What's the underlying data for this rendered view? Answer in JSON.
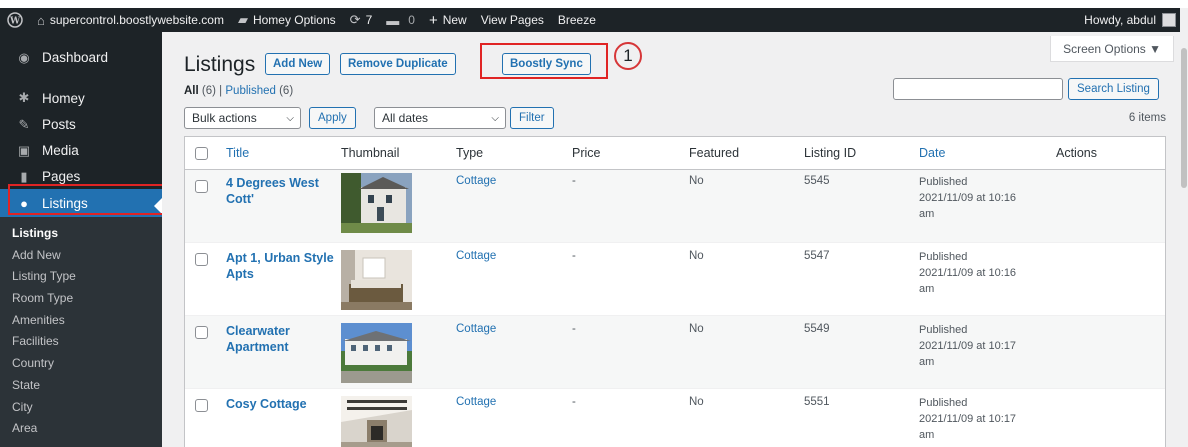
{
  "adminbar": {
    "site": "supercontrol.boostlywebsite.com",
    "homey_options": "Homey Options",
    "updates_count": "7",
    "comments_count": "0",
    "new_label": "New",
    "view_pages": "View Pages",
    "breeze": "Breeze",
    "howdy": "Howdy, abdul"
  },
  "sidebar": {
    "items": [
      {
        "label": "Dashboard",
        "icon": "dashboard-icon"
      },
      {
        "label": "Homey",
        "icon": "gear-icon"
      },
      {
        "label": "Posts",
        "icon": "pin-icon"
      },
      {
        "label": "Media",
        "icon": "media-icon"
      },
      {
        "label": "Pages",
        "icon": "page-icon"
      },
      {
        "label": "Listings",
        "icon": "location-pin-icon"
      }
    ],
    "submenu": [
      "Listings",
      "Add New",
      "Listing Type",
      "Room Type",
      "Amenities",
      "Facilities",
      "Country",
      "State",
      "City",
      "Area"
    ]
  },
  "header": {
    "title": "Listings",
    "add_new": "Add New",
    "remove_duplicate": "Remove Duplicate",
    "boostly_sync": "Boostly Sync",
    "annotation_number": "1",
    "screen_options": "Screen Options ▼"
  },
  "views": {
    "all_label": "All",
    "all_count": "(6)",
    "sep": "|",
    "published_label": "Published",
    "published_count": "(6)"
  },
  "search": {
    "button": "Search Listing",
    "value": ""
  },
  "filters": {
    "bulk_actions": "Bulk actions",
    "apply": "Apply",
    "all_dates": "All dates",
    "filter": "Filter",
    "items_count": "6 items"
  },
  "table": {
    "columns": {
      "title": "Title",
      "thumbnail": "Thumbnail",
      "type": "Type",
      "price": "Price",
      "featured": "Featured",
      "listing_id": "Listing ID",
      "date": "Date",
      "actions": "Actions"
    },
    "rows": [
      {
        "title": "4 Degrees West Cott'",
        "type": "Cottage",
        "price": "-",
        "featured": "No",
        "listing_id": "5545",
        "status": "Published",
        "date": "2021/11/09 at 10:16",
        "ampm": "am"
      },
      {
        "title": "Apt 1, Urban Style Apts",
        "type": "Cottage",
        "price": "-",
        "featured": "No",
        "listing_id": "5547",
        "status": "Published",
        "date": "2021/11/09 at 10:16",
        "ampm": "am"
      },
      {
        "title": "Clearwater Apartment",
        "type": "Cottage",
        "price": "-",
        "featured": "No",
        "listing_id": "5549",
        "status": "Published",
        "date": "2021/11/09 at 10:17",
        "ampm": "am"
      },
      {
        "title": "Cosy Cottage",
        "type": "Cottage",
        "price": "-",
        "featured": "No",
        "listing_id": "5551",
        "status": "Published",
        "date": "2021/11/09 at 10:17",
        "ampm": "am"
      }
    ]
  },
  "colors": {
    "accent": "#2271b1",
    "sidebar_bg": "#1d2327",
    "highlight_red": "#e02424"
  }
}
